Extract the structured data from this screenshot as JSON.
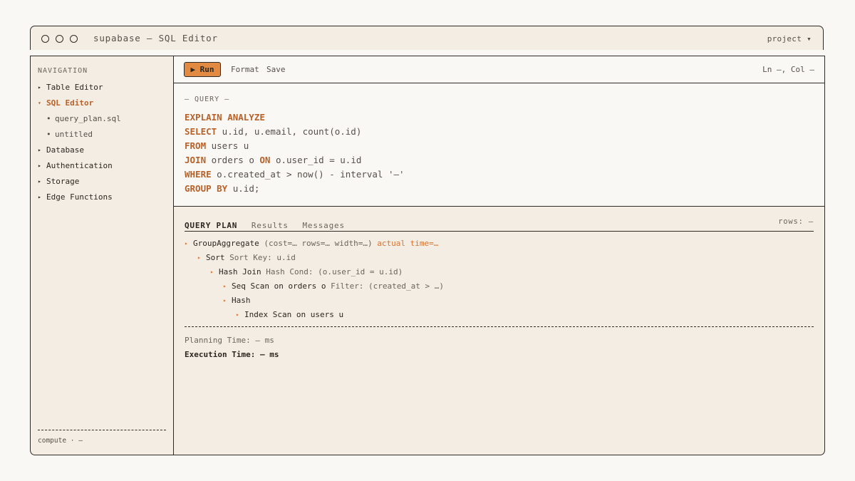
{
  "window": {
    "title": "supabase — SQL Editor",
    "project_menu": "project ▾"
  },
  "sidebar": {
    "heading": "NAVIGATION",
    "items": [
      {
        "caret": "▸",
        "label": "Table Editor"
      },
      {
        "caret": "▾",
        "label": "SQL Editor"
      },
      {
        "caret": "•",
        "label": "query_plan.sql"
      },
      {
        "caret": "•",
        "label": "untitled"
      },
      {
        "caret": "▸",
        "label": "Database"
      },
      {
        "caret": "▸",
        "label": "Authentication"
      },
      {
        "caret": "▸",
        "label": "Storage"
      },
      {
        "caret": "▸",
        "label": "Edge Functions"
      }
    ],
    "footer": "compute · —"
  },
  "toolbar": {
    "run_label": "▶ Run",
    "format_label": "Format",
    "save_label": "Save",
    "cursor_position": "Ln —, Col —"
  },
  "editor": {
    "section_label": "— QUERY —",
    "lines": [
      [
        {
          "kw": "EXPLAIN ANALYZE"
        }
      ],
      [
        {
          "kw": "SELECT"
        },
        {
          "t": " u.id, u.email, count(o.id)"
        }
      ],
      [
        {
          "kw": "FROM"
        },
        {
          "t": " users u"
        }
      ],
      [
        {
          "kw": "JOIN"
        },
        {
          "t": " orders o "
        },
        {
          "kw": "ON"
        },
        {
          "t": " o.user_id = u.id"
        }
      ],
      [
        {
          "kw": "WHERE"
        },
        {
          "t": " o.created_at > now() - interval '—'"
        }
      ],
      [
        {
          "kw": "GROUP BY"
        },
        {
          "t": " u.id;"
        }
      ]
    ]
  },
  "results": {
    "tabs": [
      "QUERY PLAN",
      "Results",
      "Messages"
    ],
    "active_tab": "QUERY PLAN",
    "rows_label": "rows: —",
    "plan": [
      {
        "depth": 0,
        "node": "GroupAggregate",
        "detail": "(cost=… rows=… width=…)",
        "extra": "actual time=…"
      },
      {
        "depth": 1,
        "node": "Sort",
        "detail": "Sort Key: u.id",
        "extra": ""
      },
      {
        "depth": 2,
        "node": "Hash Join",
        "detail": "Hash Cond: (o.user_id = u.id)",
        "extra": ""
      },
      {
        "depth": 3,
        "node": "Seq Scan on orders o",
        "detail": "Filter: (created_at > …)",
        "extra": ""
      },
      {
        "depth": 3,
        "node": "Hash",
        "detail": "",
        "extra": ""
      },
      {
        "depth": 4,
        "node": "Index Scan on users u",
        "detail": "",
        "extra": ""
      }
    ],
    "planning_time": "Planning Time: — ms",
    "execution_time": "Execution Time: — ms"
  },
  "colors": {
    "accent": "#d8742e",
    "keyword": "#b8622a",
    "run_button": "#e28a42",
    "panel": "#f4ede3",
    "editor_bg": "#faf8f4",
    "border": "#2e2a25"
  }
}
